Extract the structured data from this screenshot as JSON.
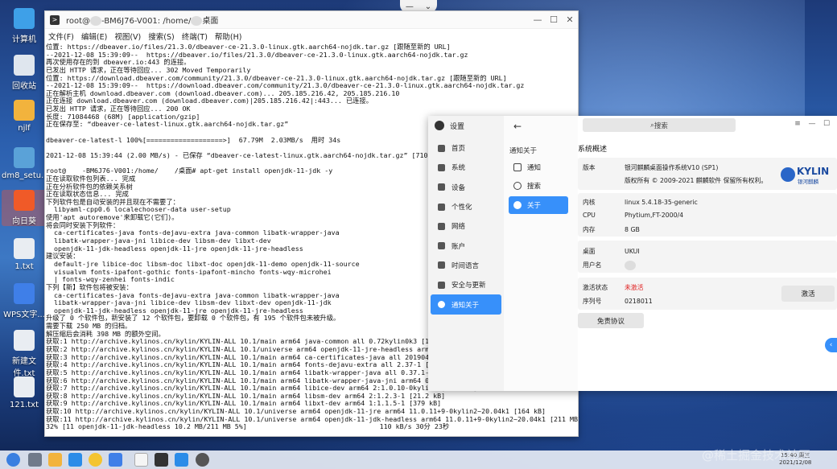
{
  "desktop": {
    "icons": [
      {
        "label": "计算机",
        "color": "#3ea0e8"
      },
      {
        "label": "回收站",
        "color": "#dfe6ee"
      },
      {
        "label": "njlf",
        "color": "#f2b33d"
      },
      {
        "label": "dm8_setu...",
        "color": "#5aa2d8"
      },
      {
        "label": "向日葵",
        "color": "#f05a28"
      },
      {
        "label": "1.txt",
        "color": "#e9edf2"
      },
      {
        "label": "WPS文字...",
        "color": "#3f7fe8"
      },
      {
        "label": "新建文件.txt",
        "color": "#e9edf2"
      },
      {
        "label": "121.txt",
        "color": "#e9edf2"
      }
    ]
  },
  "terminal": {
    "title_prefix": "root@",
    "title_host": "-BM6J76-V001: /home/",
    "title_suffix": "桌面",
    "menu": [
      "文件(F)",
      "编辑(E)",
      "视图(V)",
      "搜索(S)",
      "终端(T)",
      "帮助(H)"
    ],
    "lines": [
      "位置: https://dbeaver.io/files/21.3.0/dbeaver-ce-21.3.0-linux.gtk.aarch64-nojdk.tar.gz [跟随至新的 URL]",
      "--2021-12-08 15:39:09--  https://dbeaver.io/files/21.3.0/dbeaver-ce-21.3.0-linux.gtk.aarch64-nojdk.tar.gz",
      "再次使用存在的到 dbeaver.io:443 的连接。",
      "已发出 HTTP 请求，正在等待回应... 302 Moved Temporarily",
      "位置: https://download.dbeaver.com/community/21.3.0/dbeaver-ce-21.3.0-linux.gtk.aarch64-nojdk.tar.gz [跟随至新的 URL]",
      "--2021-12-08 15:39:09--  https://download.dbeaver.com/community/21.3.0/dbeaver-ce-21.3.0-linux.gtk.aarch64-nojdk.tar.gz",
      "正在解析主机 download.dbeaver.com (download.dbeaver.com)... 205.185.216.42, 205.185.216.10",
      "正在连接 download.dbeaver.com (download.dbeaver.com)|205.185.216.42|:443... 已连接。",
      "已发出 HTTP 请求，正在等待回应... 200 OK",
      "长度: 71084468 (68M) [application/gzip]",
      "正在保存至: “dbeaver-ce-latest-linux.gtk.aarch64-nojdk.tar.gz”",
      "",
      "dbeaver-ce-latest-l 100%[===================>]  67.79M  2.03MB/s  用时 34s",
      "",
      "2021-12-08 15:39:44 (2.00 MB/s) - 已保存 “dbeaver-ce-latest-linux.gtk.aarch64-nojdk.tar.gz” [71084",
      "",
      "root@    -BM6J76-V001:/home/    /桌面# apt-get install openjdk-11-jdk -y",
      "正在读取软件包列表... 完成",
      "正在分析软件包的依赖关系树",
      "正在读取状态信息... 完成",
      "下列软件包是自动安装的并且现在不需要了：",
      "  libyaml-cpp0.6 localechooser-data user-setup",
      "使用'apt autoremove'来卸载它(它们)。",
      "将会同时安装下列软件：",
      "  ca-certificates-java fonts-dejavu-extra java-common libatk-wrapper-java",
      "  libatk-wrapper-java-jni libice-dev libsm-dev libxt-dev",
      "  openjdk-11-jdk-headless openjdk-11-jre openjdk-11-jre-headless",
      "建议安装：",
      "  default-jre libice-doc libsm-doc libxt-doc openjdk-11-demo openjdk-11-source",
      "  visualvm fonts-ipafont-gothic fonts-ipafont-mincho fonts-wqy-microhei",
      "  | fonts-wqy-zenhei fonts-indic",
      "下列【新】软件包将被安装：",
      "  ca-certificates-java fonts-dejavu-extra java-common libatk-wrapper-java",
      "  libatk-wrapper-java-jni libice-dev libsm-dev libxt-dev openjdk-11-jdk",
      "  openjdk-11-jdk-headless openjdk-11-jre openjdk-11-jre-headless",
      "升级了 0 个软件包，新安装了 12 个软件包，要卸载 0 个软件包，有 195 个软件包未被升级。",
      "需要下载 250 MB 的归档。",
      "解压缩后会消耗 398 MB 的额外空间。",
      "获取:1 http://archive.kylinos.cn/kylin/KYLIN-ALL 10.1/main arm64 java-common all 0.72kylin0k3 [16.",
      "获取:2 http://archive.kylinos.cn/kylin/KYLIN-ALL 10.1/universe arm64 openjdk-11-jre-headless arm64",
      "获取:3 http://archive.kylinos.cn/kylin/KYLIN-ALL 10.1/main arm64 ca-certificates-java all 20190405",
      "获取:4 http://archive.kylinos.cn/kylin/KYLIN-ALL 10.1/main arm64 fonts-dejavu-extra all 2.37-1 [1,",
      "获取:5 http://archive.kylinos.cn/kylin/KYLIN-ALL 10.1/main arm64 libatk-wrapper-java all 0.37.1-1",
      "获取:6 http://archive.kylinos.cn/kylin/KYLIN-ALL 10.1/main arm64 libatk-wrapper-java-jni arm64 0.3",
      "获取:7 http://archive.kylinos.cn/kylin/KYLIN-ALL 10.1/main arm64 libice-dev arm64 2:1.0.10-0kylin1 [50.3 kB]",
      "获取:8 http://archive.kylinos.cn/kylin/KYLIN-ALL 10.1/main arm64 libsm-dev arm64 2:1.2.3-1 [21.2 kB]",
      "获取:9 http://archive.kylinos.cn/kylin/KYLIN-ALL 10.1/main arm64 libxt-dev arm64 1:1.1.5-1 [379 kB]",
      "获取:10 http://archive.kylinos.cn/kylin/KYLIN-ALL 10.1/universe arm64 openjdk-11-jre arm64 11.0.11+9-0kylin2~20.04k1 [164 kB]",
      "获取:11 http://archive.kylinos.cn/kylin/KYLIN-ALL 10.1/universe arm64 openjdk-11-jdk-headless arm64 11.0.11+9-0kylin2~20.04k1 [211 MB]",
      "32% [11 openjdk-11-jdk-headless 10.2 MB/211 MB 5%]                                 110 kB/s 30分 23秒"
    ]
  },
  "settings": {
    "title": "设置",
    "nav": [
      "首页",
      "系统",
      "设备",
      "个性化",
      "网络",
      "账户",
      "时间语言",
      "安全与更新",
      "通知关于"
    ],
    "active_nav": "通知关于",
    "sub_title": "通知关于",
    "sub_items": [
      "通知",
      "搜索",
      "关于"
    ],
    "active_sub": "关于",
    "search_placeholder": "搜索",
    "section_title": "系统概述",
    "version_label": "版本",
    "version_value": "银河麒麟桌面操作系统V10 (SP1)",
    "copyright": "版权所有 © 2009-2021 麒麟软件 保留所有权利。",
    "logo_text": "KYLIN",
    "logo_sub": "银河麒麟",
    "kernel_label": "内核",
    "kernel_value": "linux 5.4.18-35-generic",
    "cpu_label": "CPU",
    "cpu_value": "Phytium,FT-2000/4",
    "memory_label": "内存",
    "memory_value": "8 GB",
    "desktop_label": "桌面",
    "desktop_value": "UKUI",
    "username_label": "用户名",
    "username_value": "",
    "activation_label": "激活状态",
    "activation_value": "未激活",
    "serial_label": "序列号",
    "serial_value": "0218011",
    "activate_button": "激活",
    "free_button": "免责协议"
  },
  "taskbar": {
    "time": "15:40 周三",
    "date": "2021/12/08"
  },
  "watermark": "@稀土掘金技术社区"
}
